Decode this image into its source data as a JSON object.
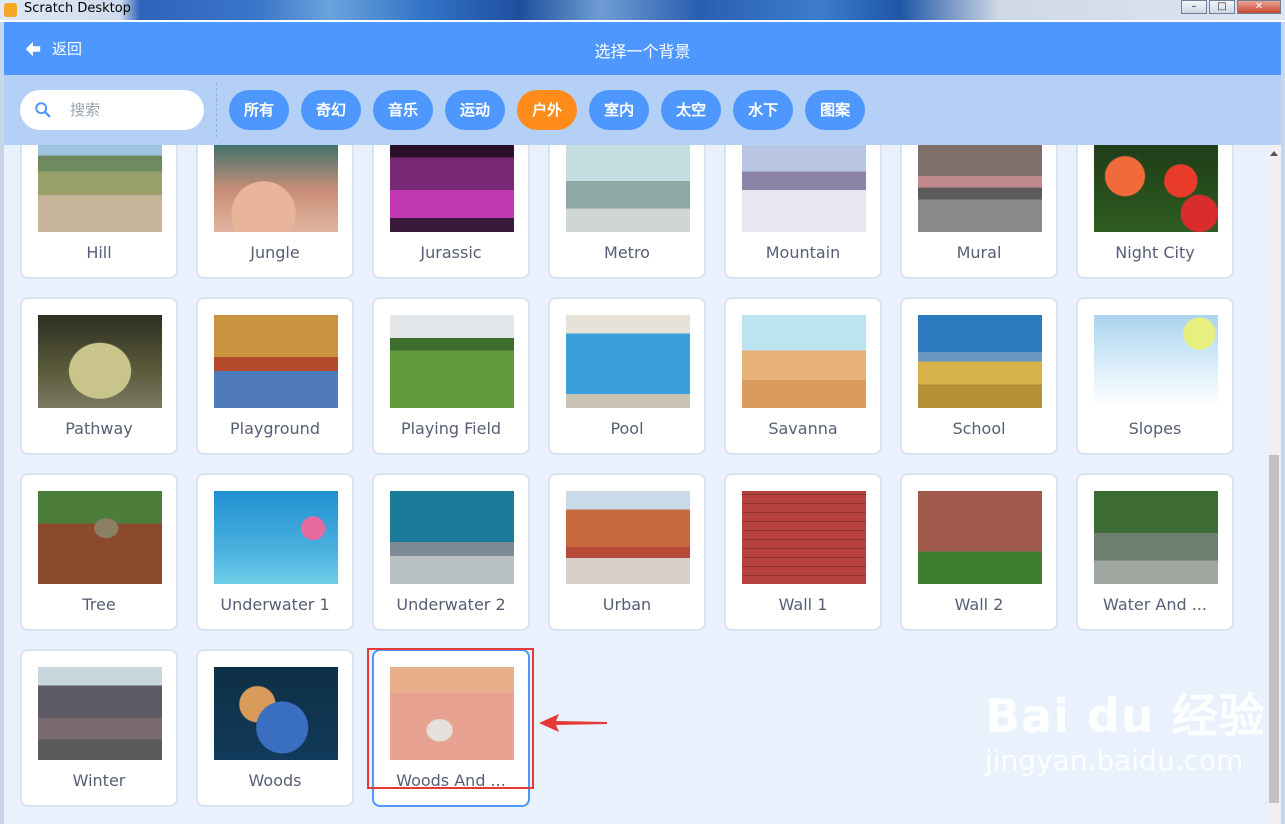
{
  "window": {
    "title": "Scratch Desktop"
  },
  "header": {
    "back_label": "返回",
    "title": "选择一个背景"
  },
  "search": {
    "placeholder": "搜索",
    "value": ""
  },
  "tags": [
    "所有",
    "奇幻",
    "音乐",
    "运动",
    "户外",
    "室内",
    "太空",
    "水下",
    "图案"
  ],
  "active_tag": "户外",
  "backdrops": [
    [
      "Hill",
      "Jungle",
      "Jurassic",
      "Metro",
      "Mountain",
      "Mural",
      "Night City"
    ],
    [
      "Pathway",
      "Playground",
      "Playing Field",
      "Pool",
      "Savanna",
      "School",
      "Slopes"
    ],
    [
      "Tree",
      "Underwater 1",
      "Underwater 2",
      "Urban",
      "Wall 1",
      "Wall 2",
      "Water And ..."
    ],
    [
      "Winter",
      "Woods",
      "Woods And ..."
    ]
  ],
  "selected_backdrop": "Woods And ...",
  "watermark": {
    "logo": "Bai du 经验",
    "url": "jingyan.baidu.com"
  },
  "colors": {
    "accent": "#4d97ff",
    "active_tag": "#ff8c1a",
    "highlight": "#e53935"
  }
}
